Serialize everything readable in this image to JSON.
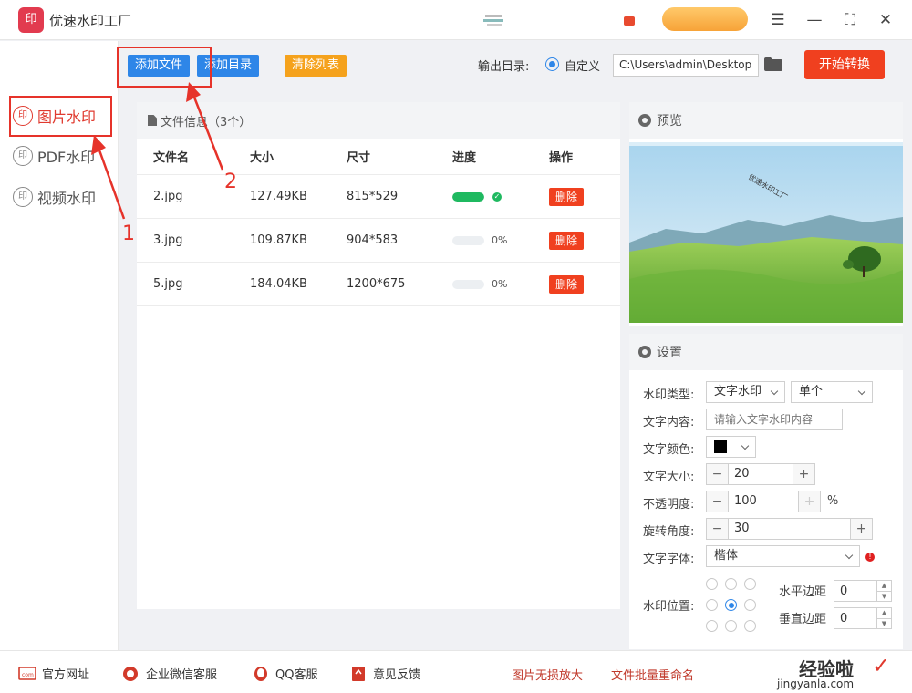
{
  "app": {
    "title": "优速水印工厂",
    "logo_text": "印"
  },
  "window": {
    "controls": [
      "menu-icon",
      "minimize-icon",
      "maximize-icon",
      "close-icon"
    ]
  },
  "sidebar": {
    "items": [
      {
        "label": "图片水印",
        "icon": "印",
        "active": true
      },
      {
        "label": "PDF水印",
        "icon": "印",
        "active": false
      },
      {
        "label": "视频水印",
        "icon": "印",
        "active": false
      }
    ]
  },
  "toolbar": {
    "add_file": "添加文件",
    "add_dir": "添加目录",
    "clear_list": "清除列表",
    "output_label": "输出目录:",
    "output_option": "自定义",
    "output_path": "C:\\Users\\admin\\Desktop",
    "start": "开始转换"
  },
  "files": {
    "header": "文件信息（3个）",
    "columns": [
      "文件名",
      "大小",
      "尺寸",
      "进度",
      "操作"
    ],
    "rows": [
      {
        "name": "2.jpg",
        "size": "127.49KB",
        "dims": "815*529",
        "progress": 1.0,
        "pct": "",
        "action": "删除"
      },
      {
        "name": "3.jpg",
        "size": "109.87KB",
        "dims": "904*583",
        "progress": 0.0,
        "pct": "0%",
        "action": "删除"
      },
      {
        "name": "5.jpg",
        "size": "184.04KB",
        "dims": "1200*675",
        "progress": 0.0,
        "pct": "0%",
        "action": "删除"
      }
    ]
  },
  "preview": {
    "title": "预览",
    "watermark_sample": "优速水印工厂"
  },
  "settings": {
    "title": "设置",
    "type_label": "水印类型:",
    "type_value": "文字水印",
    "mode_value": "单个",
    "content_label": "文字内容:",
    "content_placeholder": "请输入文字水印内容",
    "color_label": "文字颜色:",
    "color_value": "#000000",
    "size_label": "文字大小:",
    "size_value": "20",
    "opacity_label": "不透明度:",
    "opacity_value": "100",
    "opacity_unit": "%",
    "rotate_label": "旋转角度:",
    "rotate_value": "30",
    "font_label": "文字字体:",
    "font_value": "楷体",
    "position_label": "水印位置:",
    "position_selected": 4,
    "h_margin_label": "水平边距",
    "h_margin_value": "0",
    "v_margin_label": "垂直边距",
    "v_margin_value": "0"
  },
  "footer": {
    "links": [
      "官方网址",
      "企业微信客服",
      "QQ客服",
      "意见反馈"
    ],
    "promos": [
      "图片无损放大",
      "文件批量重命名"
    ],
    "brand_main": "经验啦",
    "brand_sub": "jingyanla.com"
  },
  "annotations": {
    "step1": "1",
    "step2": "2"
  },
  "colors": {
    "accent_red": "#f0401f",
    "accent_blue": "#2e86e8",
    "accent_orange": "#f5a21c",
    "progress_green": "#1fb960",
    "annotation": "#e6332a"
  }
}
